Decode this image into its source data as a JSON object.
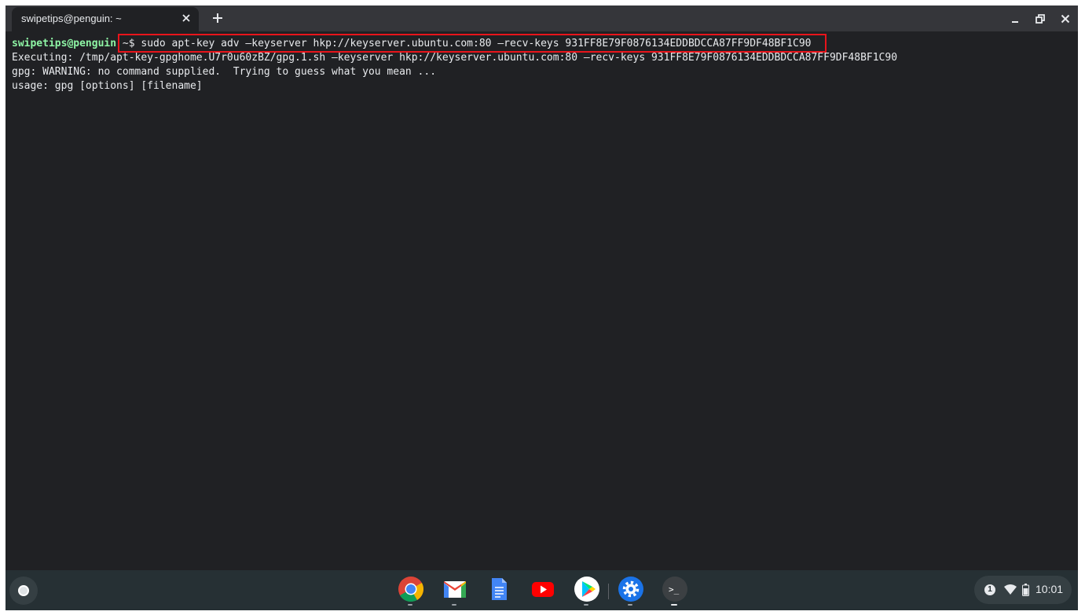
{
  "window": {
    "tab_title": "swipetips@penguin: ~"
  },
  "terminal": {
    "prompt_user": "swipetips@penguin",
    "prompt_path": "~$",
    "command": " sudo apt-key adv –keyserver hkp://keyserver.ubuntu.com:80 –recv-keys 931FF8E79F0876134EDDBDCCA87FF9DF48BF1C90",
    "output": [
      "Executing: /tmp/apt-key-gpghome.U7r0u60zBZ/gpg.1.sh –keyserver hkp://keyserver.ubuntu.com:80 –recv-keys 931FF8E79F0876134EDDBDCCA87FF9DF48BF1C90",
      "gpg: WARNING: no command supplied.  Trying to guess what you mean ...",
      "usage: gpg [options] [filename]"
    ],
    "highlight_color": "#e8141b"
  },
  "shelf": {
    "apps": [
      {
        "name": "chrome-icon",
        "running": true
      },
      {
        "name": "gmail-icon",
        "running": true
      },
      {
        "name": "docs-icon",
        "running": false
      },
      {
        "name": "youtube-icon",
        "running": false
      },
      {
        "name": "play-store-icon",
        "running": true
      },
      {
        "name": "settings-icon",
        "running": true
      },
      {
        "name": "terminal-icon",
        "running": true,
        "active": true
      }
    ],
    "terminal_glyph": ">_",
    "notification_count": "1",
    "time": "10:01"
  }
}
